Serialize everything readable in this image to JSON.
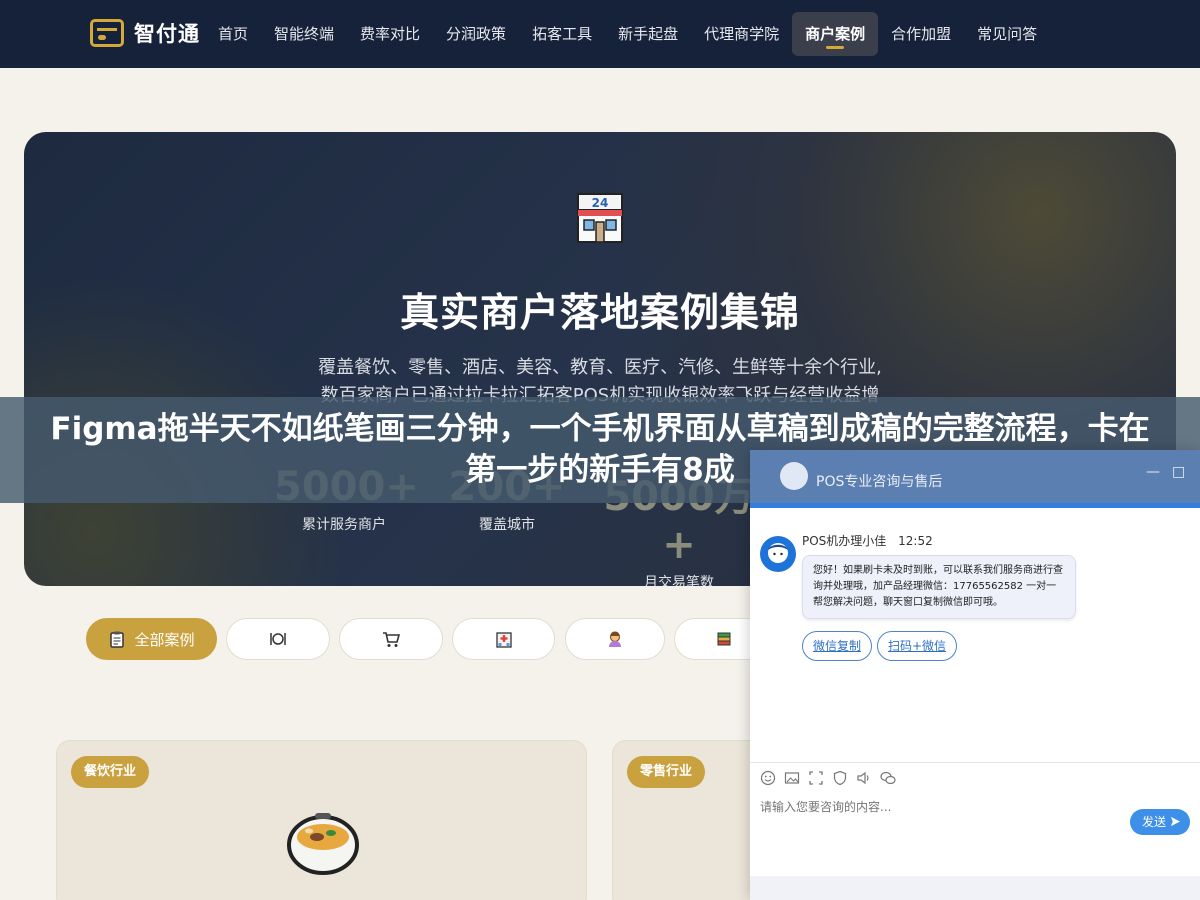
{
  "nav": {
    "logo_text": "智付通",
    "items": [
      "首页",
      "智能终端",
      "费率对比",
      "分润政策",
      "拓客工具",
      "新手起盘",
      "代理商学院",
      "商户案例",
      "合作加盟",
      "常见问答"
    ],
    "active_index": 7,
    "accent_color": "#d4a93a"
  },
  "hero": {
    "icon": "convenience-store-icon",
    "icon_label": "24",
    "title": "真实商户落地案例集锦",
    "desc_line1": "覆盖餐饮、零售、酒店、美容、教育、医疗、汽修、生鲜等十余个行业,",
    "desc_line2": "数百家商户已通过拉卡拉汇拓客POS机实现收银效率飞跃与经营收益增",
    "stats": [
      {
        "value": "5000+",
        "label": "累计服务商户"
      },
      {
        "value": "200+",
        "label": "覆盖城市"
      },
      {
        "value": "5000万+",
        "label": "月交易笔数"
      }
    ]
  },
  "banner": {
    "text": "Figma拖半天不如纸笔画三分钟，一个手机界面从草稿到成稿的完整流程，卡在第一步的新手有8成"
  },
  "filters": {
    "items": [
      {
        "label": "全部案例",
        "icon": "clipboard-icon"
      },
      {
        "label": "",
        "icon": "dining-icon"
      },
      {
        "label": "",
        "icon": "cart-icon"
      },
      {
        "label": "",
        "icon": "hospital-icon"
      },
      {
        "label": "",
        "icon": "person-icon"
      },
      {
        "label": "",
        "icon": "books-icon"
      }
    ],
    "active_index": 0
  },
  "cards": [
    {
      "badge": "餐饮行业",
      "icon": "food-bowl-icon"
    },
    {
      "badge": "零售行业",
      "icon": ""
    }
  ],
  "chat": {
    "title": "POS专业咨询与售后",
    "agent_name": "POS机办理小佳",
    "time": "12:52",
    "message": "您好！如果刷卡未及时到账，可以联系我们服务商进行查询并处理哦，加产品经理微信：17765562582 一对一帮您解决问题，聊天窗口复制微信即可哦。",
    "buttons": [
      "微信复制",
      "扫码+微信"
    ],
    "input_placeholder": "请输入您要咨询的内容...",
    "send_label": "发送",
    "minimize": "—",
    "maximize": "□"
  }
}
